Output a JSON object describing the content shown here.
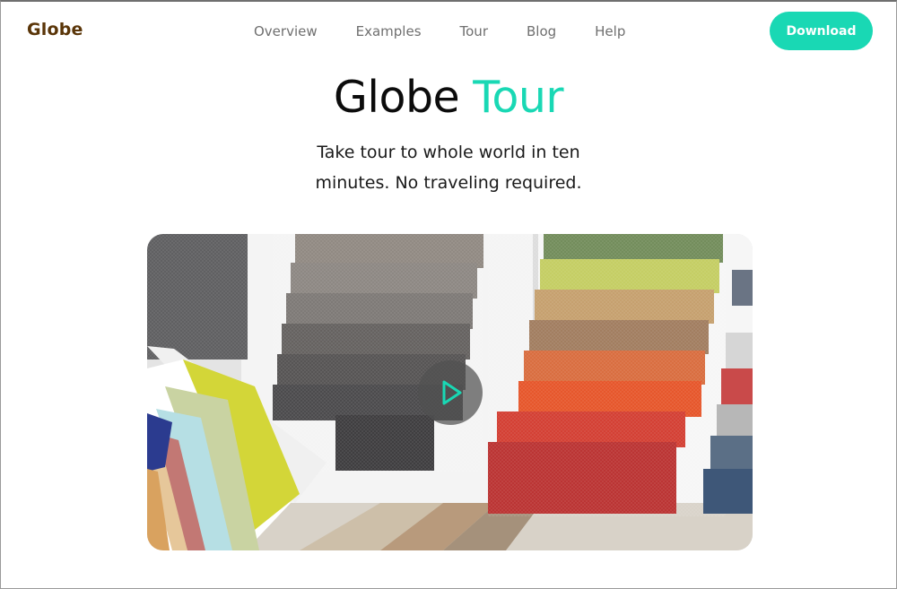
{
  "header": {
    "logo": "Globe",
    "nav": [
      "Overview",
      "Examples",
      "Tour",
      "Blog",
      "Help"
    ],
    "download_label": "Download"
  },
  "hero": {
    "title_main": "Globe",
    "title_accent": "Tour",
    "subtitle_line1": "Take tour to whole world in ten",
    "subtitle_line2": "minutes. No traveling required."
  },
  "media": {
    "play_icon": "play-icon",
    "image_subject": "fabric and color swatch samples"
  },
  "colors": {
    "accent": "#19d8b4",
    "logo": "#5a3508",
    "nav": "#6f6f6f"
  }
}
